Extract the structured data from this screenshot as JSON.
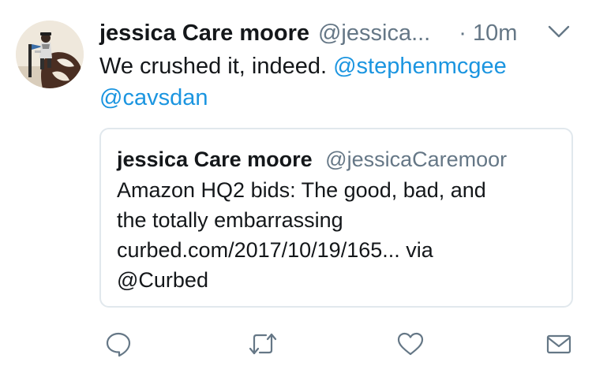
{
  "tweet": {
    "author": {
      "display_name": "jessica Care moore",
      "handle": "@jessica...",
      "avatar_icon": "avatar-photo"
    },
    "timestamp": "· 10m",
    "text_plain": "We crushed it, indeed.",
    "mentions": [
      "@stephenmcgee",
      "@cavsdan"
    ],
    "menu_icon": "chevron-down-icon"
  },
  "quote": {
    "display_name": "jessica Care moore",
    "handle": "@jessicaCaremoor",
    "lines": [
      "Amazon HQ2 bids: The good, bad, and",
      "the totally embarrassing",
      "curbed.com/2017/10/19/165... via",
      "@Curbed"
    ]
  },
  "actions": [
    {
      "name": "reply",
      "icon": "reply-icon"
    },
    {
      "name": "retweet",
      "icon": "retweet-icon"
    },
    {
      "name": "like",
      "icon": "heart-icon"
    },
    {
      "name": "message",
      "icon": "mail-icon"
    }
  ],
  "colors": {
    "link": "#1b95e0",
    "secondary_text": "#657786",
    "icon": "#657786",
    "border": "#e1e8ed",
    "text": "#14171a"
  }
}
